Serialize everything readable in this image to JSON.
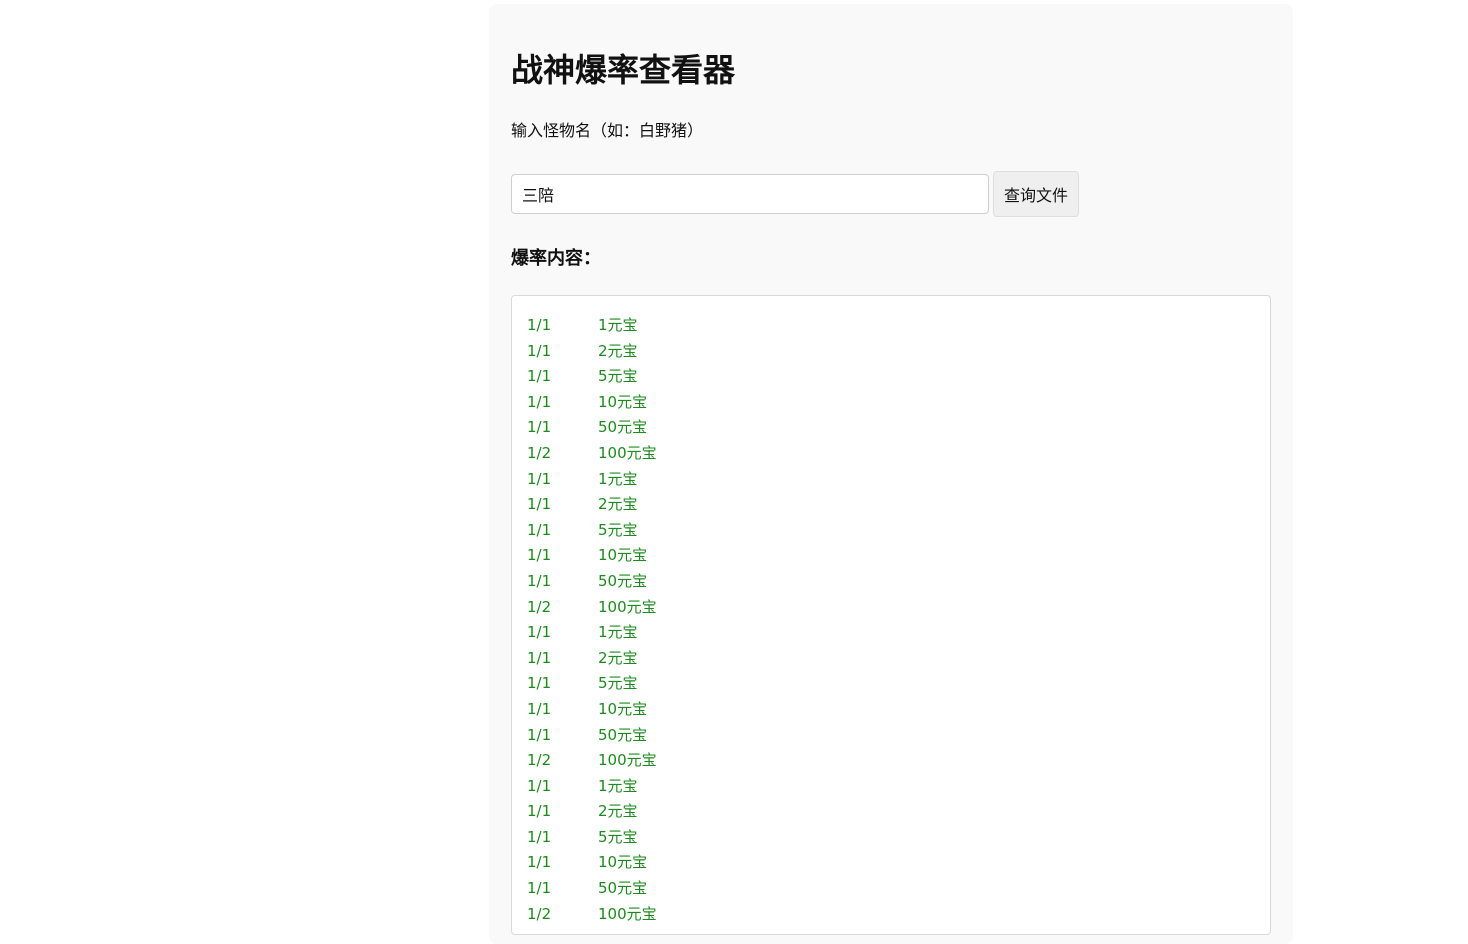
{
  "page": {
    "title": "战神爆率查看器",
    "input_label": "输入怪物名（如：白野猪）",
    "search": {
      "value": "三陪",
      "placeholder": ""
    },
    "query_button_label": "查询文件",
    "results_heading": "爆率内容：",
    "results_color": "#1d8a1d",
    "results": [
      {
        "rate": "1/1",
        "item": "1元宝"
      },
      {
        "rate": "1/1",
        "item": "2元宝"
      },
      {
        "rate": "1/1",
        "item": "5元宝"
      },
      {
        "rate": "1/1",
        "item": "10元宝"
      },
      {
        "rate": "1/1",
        "item": "50元宝"
      },
      {
        "rate": "1/2",
        "item": "100元宝"
      },
      {
        "rate": "1/1",
        "item": "1元宝"
      },
      {
        "rate": "1/1",
        "item": "2元宝"
      },
      {
        "rate": "1/1",
        "item": "5元宝"
      },
      {
        "rate": "1/1",
        "item": "10元宝"
      },
      {
        "rate": "1/1",
        "item": "50元宝"
      },
      {
        "rate": "1/2",
        "item": "100元宝"
      },
      {
        "rate": "1/1",
        "item": "1元宝"
      },
      {
        "rate": "1/1",
        "item": "2元宝"
      },
      {
        "rate": "1/1",
        "item": "5元宝"
      },
      {
        "rate": "1/1",
        "item": "10元宝"
      },
      {
        "rate": "1/1",
        "item": "50元宝"
      },
      {
        "rate": "1/2",
        "item": "100元宝"
      },
      {
        "rate": "1/1",
        "item": "1元宝"
      },
      {
        "rate": "1/1",
        "item": "2元宝"
      },
      {
        "rate": "1/1",
        "item": "5元宝"
      },
      {
        "rate": "1/1",
        "item": "10元宝"
      },
      {
        "rate": "1/1",
        "item": "50元宝"
      },
      {
        "rate": "1/2",
        "item": "100元宝"
      }
    ]
  }
}
